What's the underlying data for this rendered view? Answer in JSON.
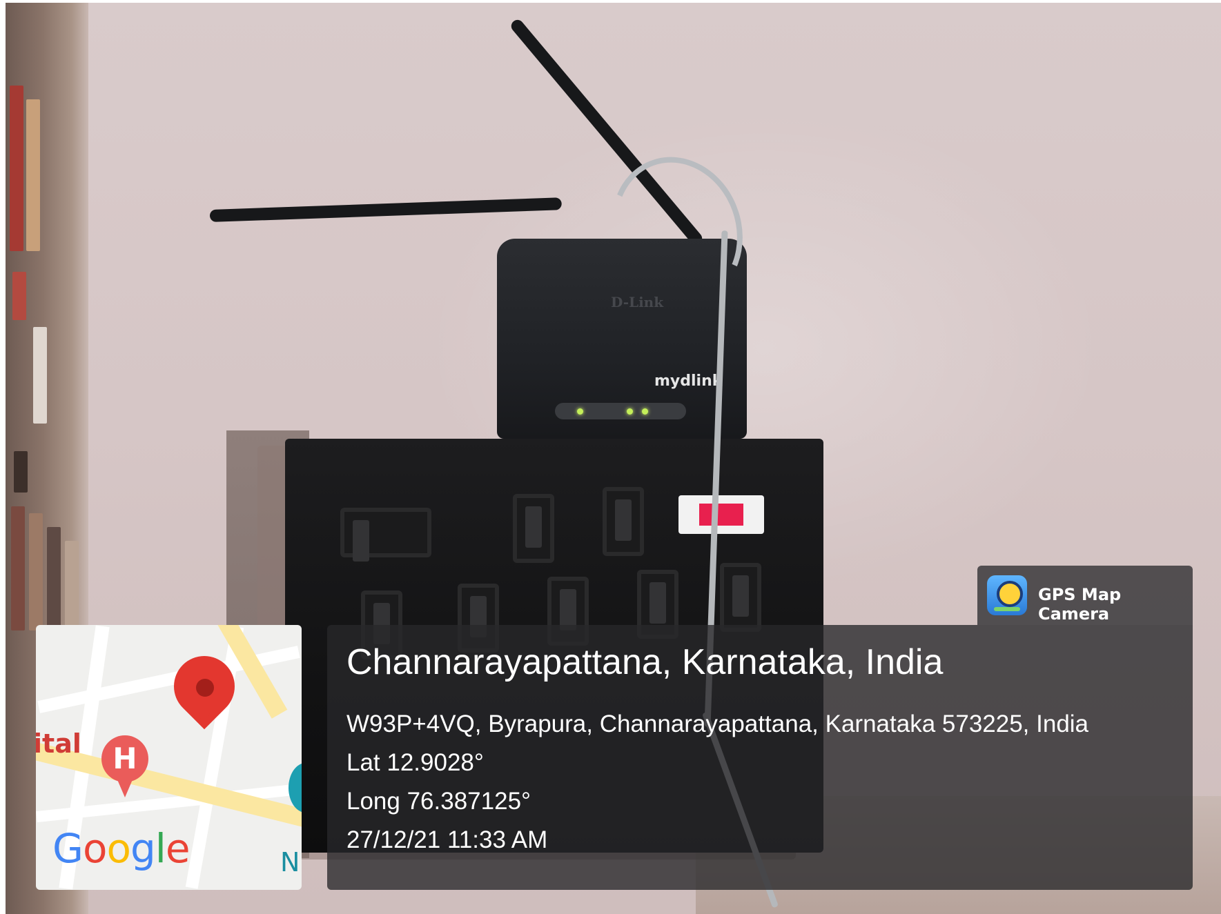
{
  "photo": {
    "router_brand": "D-Link",
    "router_logo": "mydlink"
  },
  "map": {
    "label_partial": "ital",
    "hospital_letter": "H",
    "label_right_partial": "N",
    "google_logo": [
      "G",
      "o",
      "o",
      "g",
      "l",
      "e"
    ],
    "google_colors": [
      "#4285F4",
      "#EA4335",
      "#FBBC05",
      "#4285F4",
      "#34A853",
      "#EA4335"
    ]
  },
  "stamp": {
    "app_name": "GPS Map Camera",
    "location_title": "Channarayapattana, Karnataka, India",
    "address": "W93P+4VQ, Byrapura, Channarayapattana, Karnataka 573225, India",
    "latitude": "Lat 12.9028°",
    "longitude": "Long 76.387125°",
    "datetime": "27/12/21 11:33 AM"
  }
}
